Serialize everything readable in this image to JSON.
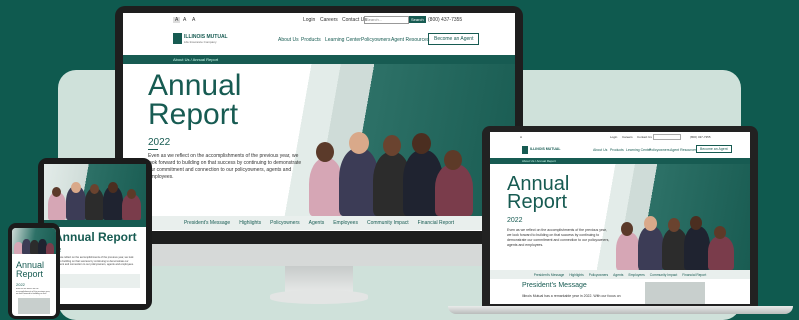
{
  "colors": {
    "brand": "#175b52",
    "background": "#0f5a4f",
    "stage": "#cfe1da"
  },
  "topbar": {
    "font_sizes": [
      "A",
      "A",
      "A"
    ],
    "links": [
      "Login",
      "Careers",
      "Contact Us"
    ],
    "search_placeholder": "Search...",
    "search_button": "Search",
    "phone": "(800) 437-7355"
  },
  "logo": {
    "name": "ILLINOIS MUTUAL",
    "tagline": "Life Insurance Company",
    "icon": "illinois-mutual-logo-icon"
  },
  "nav": {
    "items": [
      "About Us",
      "Products",
      "Learning Center",
      "Policyowners",
      "Agent Resources"
    ],
    "cta": "Become an Agent"
  },
  "breadcrumb": "About Us / Annual Report",
  "hero": {
    "title_line1": "Annual",
    "title_line2": "Report",
    "year": "2022",
    "body": "Even as we reflect on the accomplishments of the previous year, we look forward to building on that success by continuing to demonstrate our commitment and connection to our policyowners, agents and employees."
  },
  "tabs": [
    "President's Message",
    "Highlights",
    "Policyowners",
    "Agents",
    "Employees",
    "Community Impact",
    "Financial Report"
  ],
  "laptop": {
    "section_title": "President's Message",
    "section_text": "Illinois Mutual has a remarkable year in 2022. With our focus on"
  },
  "tablet": {
    "title": "Annual Report",
    "heading": "2022"
  },
  "phone": {
    "title_line1": "Annual",
    "title_line2": "Report",
    "year": "2022"
  }
}
